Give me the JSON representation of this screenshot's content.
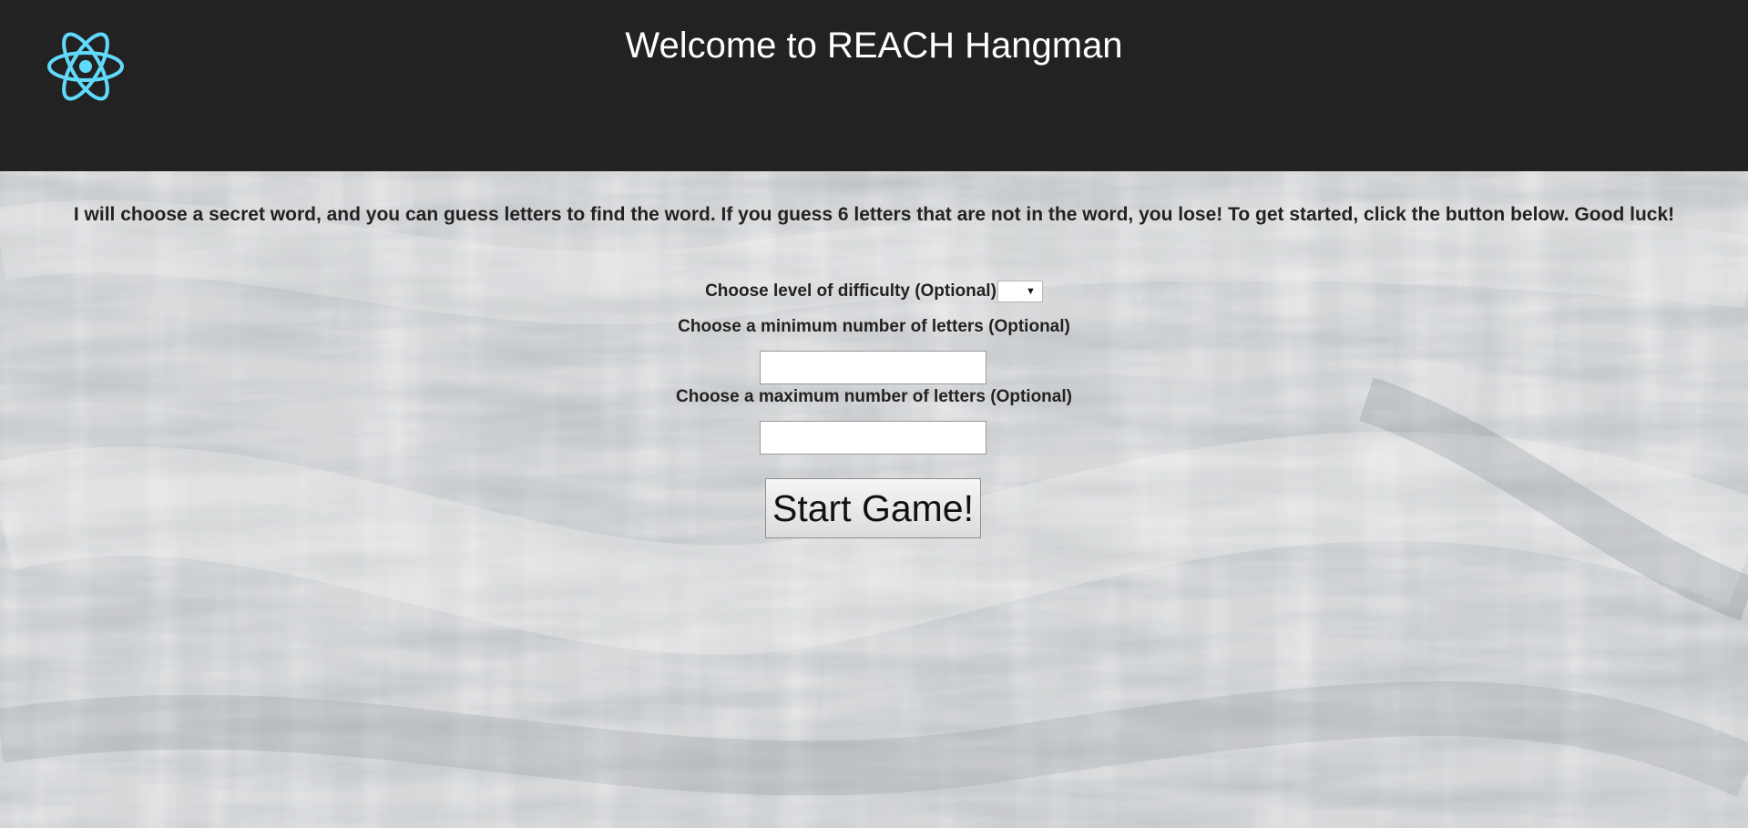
{
  "header": {
    "title": "Welcome to REACH Hangman",
    "logo_icon": "react-atom-icon",
    "logo_color": "#61dafb",
    "background_color": "#222222"
  },
  "main": {
    "intro_text": "I will choose a secret word, and you can guess letters to find the word. If you guess 6 letters that are not in the word, you lose! To get started, click the button below. Good luck!",
    "difficulty_label": "Choose level of difficulty (Optional)",
    "difficulty_value": "",
    "min_letters_label": "Choose a minimum number of letters (Optional)",
    "min_letters_value": "",
    "max_letters_label": "Choose a maximum number of letters (Optional)",
    "max_letters_value": "",
    "start_button_label": "Start Game!"
  }
}
